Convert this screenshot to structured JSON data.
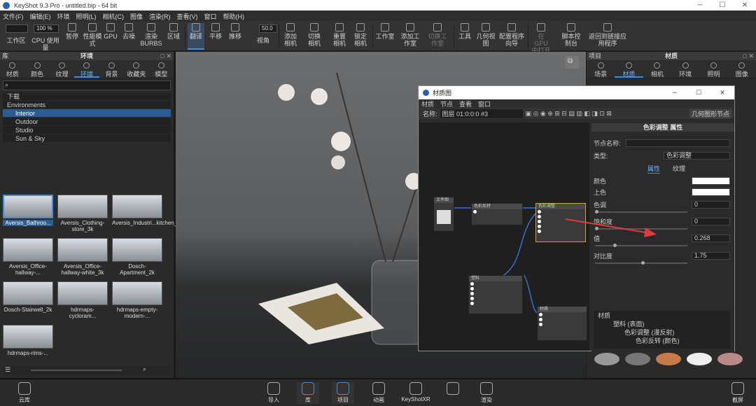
{
  "titlebar": {
    "app": "KeyShot 9.3 Pro",
    "file": "untitled.bip",
    "bits": "64 bit"
  },
  "menu": [
    "文件(F)",
    "编辑(E)",
    "环境",
    "照明(L)",
    "相机(C)",
    "图像",
    "渲染(R)",
    "查看(V)",
    "窗口",
    "帮助(H)"
  ],
  "toolbar": {
    "zoom": "100 %",
    "fov": "50.0",
    "items": [
      "工作区",
      "CPU 使用量",
      "暂停",
      "性能模式",
      "GPU",
      "去噪",
      "渲染 BURBS",
      "区域",
      "翻译",
      "平移",
      "推移",
      "视角",
      "添加相机",
      "切换相机",
      "重置相机",
      "锁定相机",
      "工作室",
      "添加工作室",
      "切换工作室",
      "工具",
      "几何视图",
      "配置程序向导",
      "在 GPU 中打开",
      "脚本控制台",
      "返回到链接应用程序"
    ]
  },
  "left": {
    "title": "库",
    "env_title": "环境",
    "tabs": [
      "材质",
      "颜色",
      "纹理",
      "环境",
      "背景",
      "收藏夹",
      "模型"
    ],
    "tree": [
      "下载",
      "Environments",
      "Interior",
      "Outdoor",
      "Studio",
      "Sun & Sky"
    ],
    "thumbs": [
      "Aversis_Bathroo...",
      "Aversis_Clothing-store_3k",
      "Aversis_Industri...kitchen_3k",
      "Aversis_Office-hallway-...",
      "Aversis_Office-hallway-white_3k",
      "Dosch-Apartment_2k",
      "Dosch-Stairwell_2k",
      "hdrmaps-cycloram...",
      "hdrmaps-empty-modern-...",
      "hdrmaps-rims-..."
    ]
  },
  "right": {
    "project": "项目",
    "title": "材质",
    "tabs": [
      "场景",
      "材质",
      "相机",
      "环境",
      "照明",
      "图像"
    ],
    "prop_header": "色彩调整 属性",
    "node_name_label": "节点名称:",
    "type_label": "类型:",
    "type_value": "色彩调整",
    "subtabs": [
      "属性",
      "纹理"
    ],
    "props": [
      {
        "label": "颜色",
        "value": ""
      },
      {
        "label": "上色",
        "value": ""
      },
      {
        "label": "色调",
        "value": "0"
      },
      {
        "label": "饱和度",
        "value": "0"
      },
      {
        "label": "值",
        "value": "0.268"
      },
      {
        "label": "对比度",
        "value": "1.75"
      }
    ],
    "tree": [
      "材质",
      "塑料 (表面)",
      "色彩调整 (漫反射)",
      "色彩反转 (颜色)"
    ]
  },
  "matwin": {
    "title": "材质图",
    "menu": [
      "材质",
      "节点",
      "查看",
      "窗口"
    ],
    "name_label": "名称:",
    "name_value": "图层 01:0:0:0 #3",
    "geom_btn": "几何图形节点",
    "nodes": {
      "n1": "文件图",
      "n2": "色彩反转",
      "n3": "色彩调整",
      "n4": "塑料",
      "n5": "材质"
    }
  },
  "bottom": {
    "items": [
      "云库",
      "导入",
      "库",
      "项目",
      "动画",
      "KeyShotXR",
      "渲染",
      "截屏"
    ]
  },
  "colors": {
    "accent": "#3a8fe0",
    "arrow": "#e03a3a"
  }
}
